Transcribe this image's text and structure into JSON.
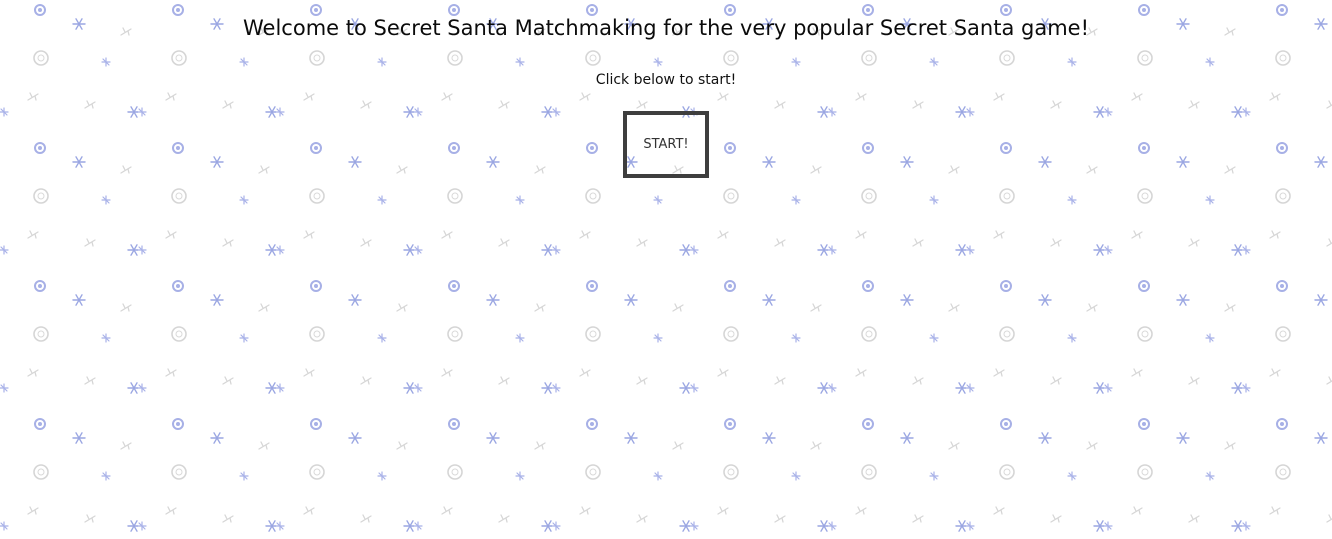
{
  "page": {
    "title": "Welcome to Secret Santa Matchmaking for the very popular Secret Santa game!",
    "instruction": "Click below to start!",
    "start_button_label": "START!"
  },
  "background": {
    "pattern": "snowflake-icons",
    "color": "#ffffff",
    "flake_colors": [
      "#aab3e6",
      "#9aa5e0",
      "#cfcfcf"
    ]
  }
}
